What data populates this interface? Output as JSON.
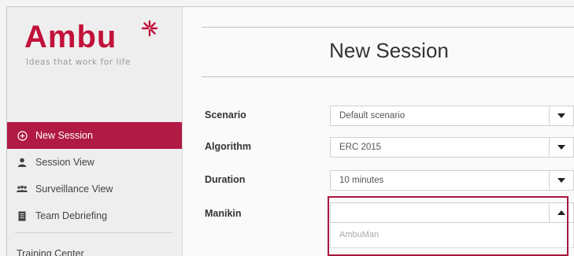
{
  "brand": {
    "logo_text": "Ambu",
    "tagline": "Ideas that work for life",
    "accent_color": "#c2113a"
  },
  "sidebar": {
    "items": [
      {
        "label": "New Session",
        "icon": "plus-circle-icon",
        "active": true
      },
      {
        "label": "Session View",
        "icon": "person-icon",
        "active": false
      },
      {
        "label": "Surveillance View",
        "icon": "group-icon",
        "active": false
      },
      {
        "label": "Team Debriefing",
        "icon": "document-icon",
        "active": false
      }
    ],
    "partial_item_label": "Training Center"
  },
  "main": {
    "title": "New Session",
    "fields": [
      {
        "label": "Scenario",
        "value": "Default scenario"
      },
      {
        "label": "Algorithm",
        "value": "ERC 2015"
      },
      {
        "label": "Duration",
        "value": "10 minutes"
      },
      {
        "label": "Manikin",
        "value": ""
      }
    ],
    "manikin_options": [
      "AmbuMan"
    ]
  }
}
